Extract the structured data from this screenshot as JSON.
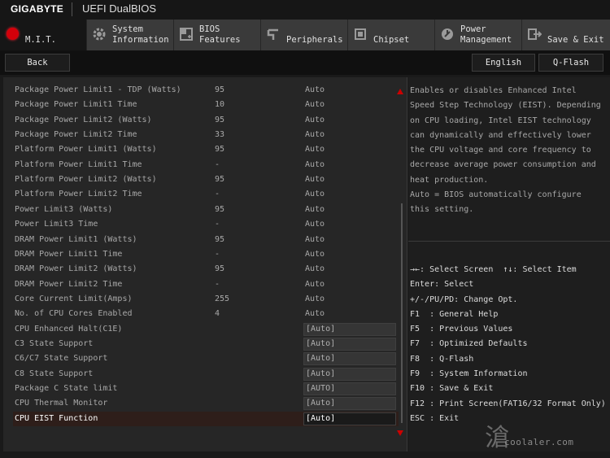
{
  "header": {
    "brand": "GIGABYTE",
    "title": "UEFI DualBIOS"
  },
  "tabs": [
    {
      "label": "M.I.T.",
      "icon": "mit-red-dot-icon",
      "active": true
    },
    {
      "label": "System\nInformation",
      "icon": "gear-icon"
    },
    {
      "label": "BIOS\nFeatures",
      "icon": "plus-window-icon"
    },
    {
      "label": "Peripherals",
      "icon": "plug-icon"
    },
    {
      "label": "Chipset",
      "icon": "chip-icon"
    },
    {
      "label": "Power\nManagement",
      "icon": "power-icon"
    },
    {
      "label": "Save & Exit",
      "icon": "exit-icon"
    }
  ],
  "subbar": {
    "back_label": "Back",
    "language_label": "English",
    "qflash_label": "Q-Flash"
  },
  "settings": [
    {
      "name": "Package Power Limit1 - TDP (Watts)",
      "current": "95",
      "value": "Auto"
    },
    {
      "name": "Package Power Limit1 Time",
      "current": "10",
      "value": "Auto"
    },
    {
      "name": "Package Power Limit2 (Watts)",
      "current": "95",
      "value": "Auto"
    },
    {
      "name": "Package Power Limit2 Time",
      "current": "33",
      "value": "Auto"
    },
    {
      "name": "Platform Power Limit1 (Watts)",
      "current": "95",
      "value": "Auto"
    },
    {
      "name": "Platform Power Limit1 Time",
      "current": "-",
      "value": "Auto"
    },
    {
      "name": "Platform Power Limit2 (Watts)",
      "current": "95",
      "value": "Auto"
    },
    {
      "name": "Platform Power Limit2 Time",
      "current": "-",
      "value": "Auto"
    },
    {
      "name": "Power Limit3 (Watts)",
      "current": "95",
      "value": "Auto"
    },
    {
      "name": "Power Limit3 Time",
      "current": "-",
      "value": "Auto"
    },
    {
      "name": "DRAM Power Limit1 (Watts)",
      "current": "95",
      "value": "Auto"
    },
    {
      "name": "DRAM Power Limit1 Time",
      "current": "-",
      "value": "Auto"
    },
    {
      "name": "DRAM Power Limit2 (Watts)",
      "current": "95",
      "value": "Auto"
    },
    {
      "name": "DRAM Power Limit2 Time",
      "current": "-",
      "value": "Auto"
    },
    {
      "name": "Core Current Limit(Amps)",
      "current": "255",
      "value": "Auto"
    },
    {
      "name": "No. of CPU Cores Enabled",
      "current": "4",
      "value": "Auto"
    },
    {
      "name": "CPU Enhanced Halt(C1E)",
      "current": "",
      "value": "[Auto]",
      "editable": true
    },
    {
      "name": "C3 State Support",
      "current": "",
      "value": "[Auto]",
      "editable": true
    },
    {
      "name": "C6/C7 State Support",
      "current": "",
      "value": "[Auto]",
      "editable": true
    },
    {
      "name": "C8 State Support",
      "current": "",
      "value": "[Auto]",
      "editable": true
    },
    {
      "name": "Package C State limit",
      "current": "",
      "value": "[AUTO]",
      "editable": true
    },
    {
      "name": "CPU Thermal Monitor",
      "current": "",
      "value": "[Auto]",
      "editable": true
    },
    {
      "name": "CPU EIST Function",
      "current": "",
      "value": "[Auto]",
      "editable": true,
      "selected": true
    }
  ],
  "help": {
    "description": [
      "Enables or disables Enhanced Intel",
      "Speed Step Technology (EIST). Depending",
      "on CPU loading, Intel EIST technology",
      "can dynamically and effectively lower",
      "the CPU voltage and core frequency to",
      "decrease average power consumption and",
      "heat production.",
      "Auto = BIOS automatically configure",
      "this setting."
    ],
    "keys": [
      "→←: Select Screen  ↑↓: Select Item",
      "Enter: Select",
      "+/-/PU/PD: Change Opt.",
      "F1  : General Help",
      "F5  : Previous Values",
      "F7  : Optimized Defaults",
      "F8  : Q-Flash",
      "F9  : System Information",
      "F10 : Save & Exit",
      "F12 : Print Screen(FAT16/32 Format Only)",
      "ESC : Exit"
    ]
  },
  "watermark": {
    "glyph": "滄",
    "text": "coolaler.com"
  },
  "colors": {
    "accent_red": "#d4000a",
    "selected_row": "#2e1e1a"
  }
}
